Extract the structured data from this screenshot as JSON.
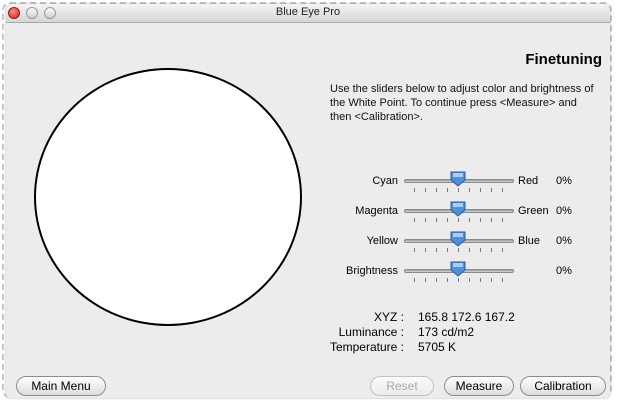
{
  "window": {
    "title": "Blue Eye Pro"
  },
  "main": {
    "heading": "Finetuning",
    "instructions": "Use the sliders below to adjust color and brightness of the White Point. To continue press <Measure> and then <Calibration>."
  },
  "sliders": [
    {
      "left_label": "Cyan",
      "right_label": "Red",
      "value": "0%"
    },
    {
      "left_label": "Magenta",
      "right_label": "Green",
      "value": "0%"
    },
    {
      "left_label": "Yellow",
      "right_label": "Blue",
      "value": "0%"
    },
    {
      "left_label": "Brightness",
      "right_label": "",
      "value": "0%"
    }
  ],
  "readouts": {
    "xyz_label": "XYZ :",
    "xyz_value": "165.8 172.6 167.2",
    "luminance_label": "Luminance :",
    "luminance_value": "173 cd/m2",
    "temperature_label": "Temperature :",
    "temperature_value": "5705 K"
  },
  "buttons": {
    "main_menu": "Main Menu",
    "reset": "Reset",
    "measure": "Measure",
    "calibration": "Calibration"
  },
  "colors": {
    "knob_blue": "#4f8fd6",
    "window_bg": "#ececec"
  },
  "icons": {
    "close": "close-button-icon",
    "minimize": "minimize-button-icon",
    "zoom": "zoom-button-icon"
  }
}
